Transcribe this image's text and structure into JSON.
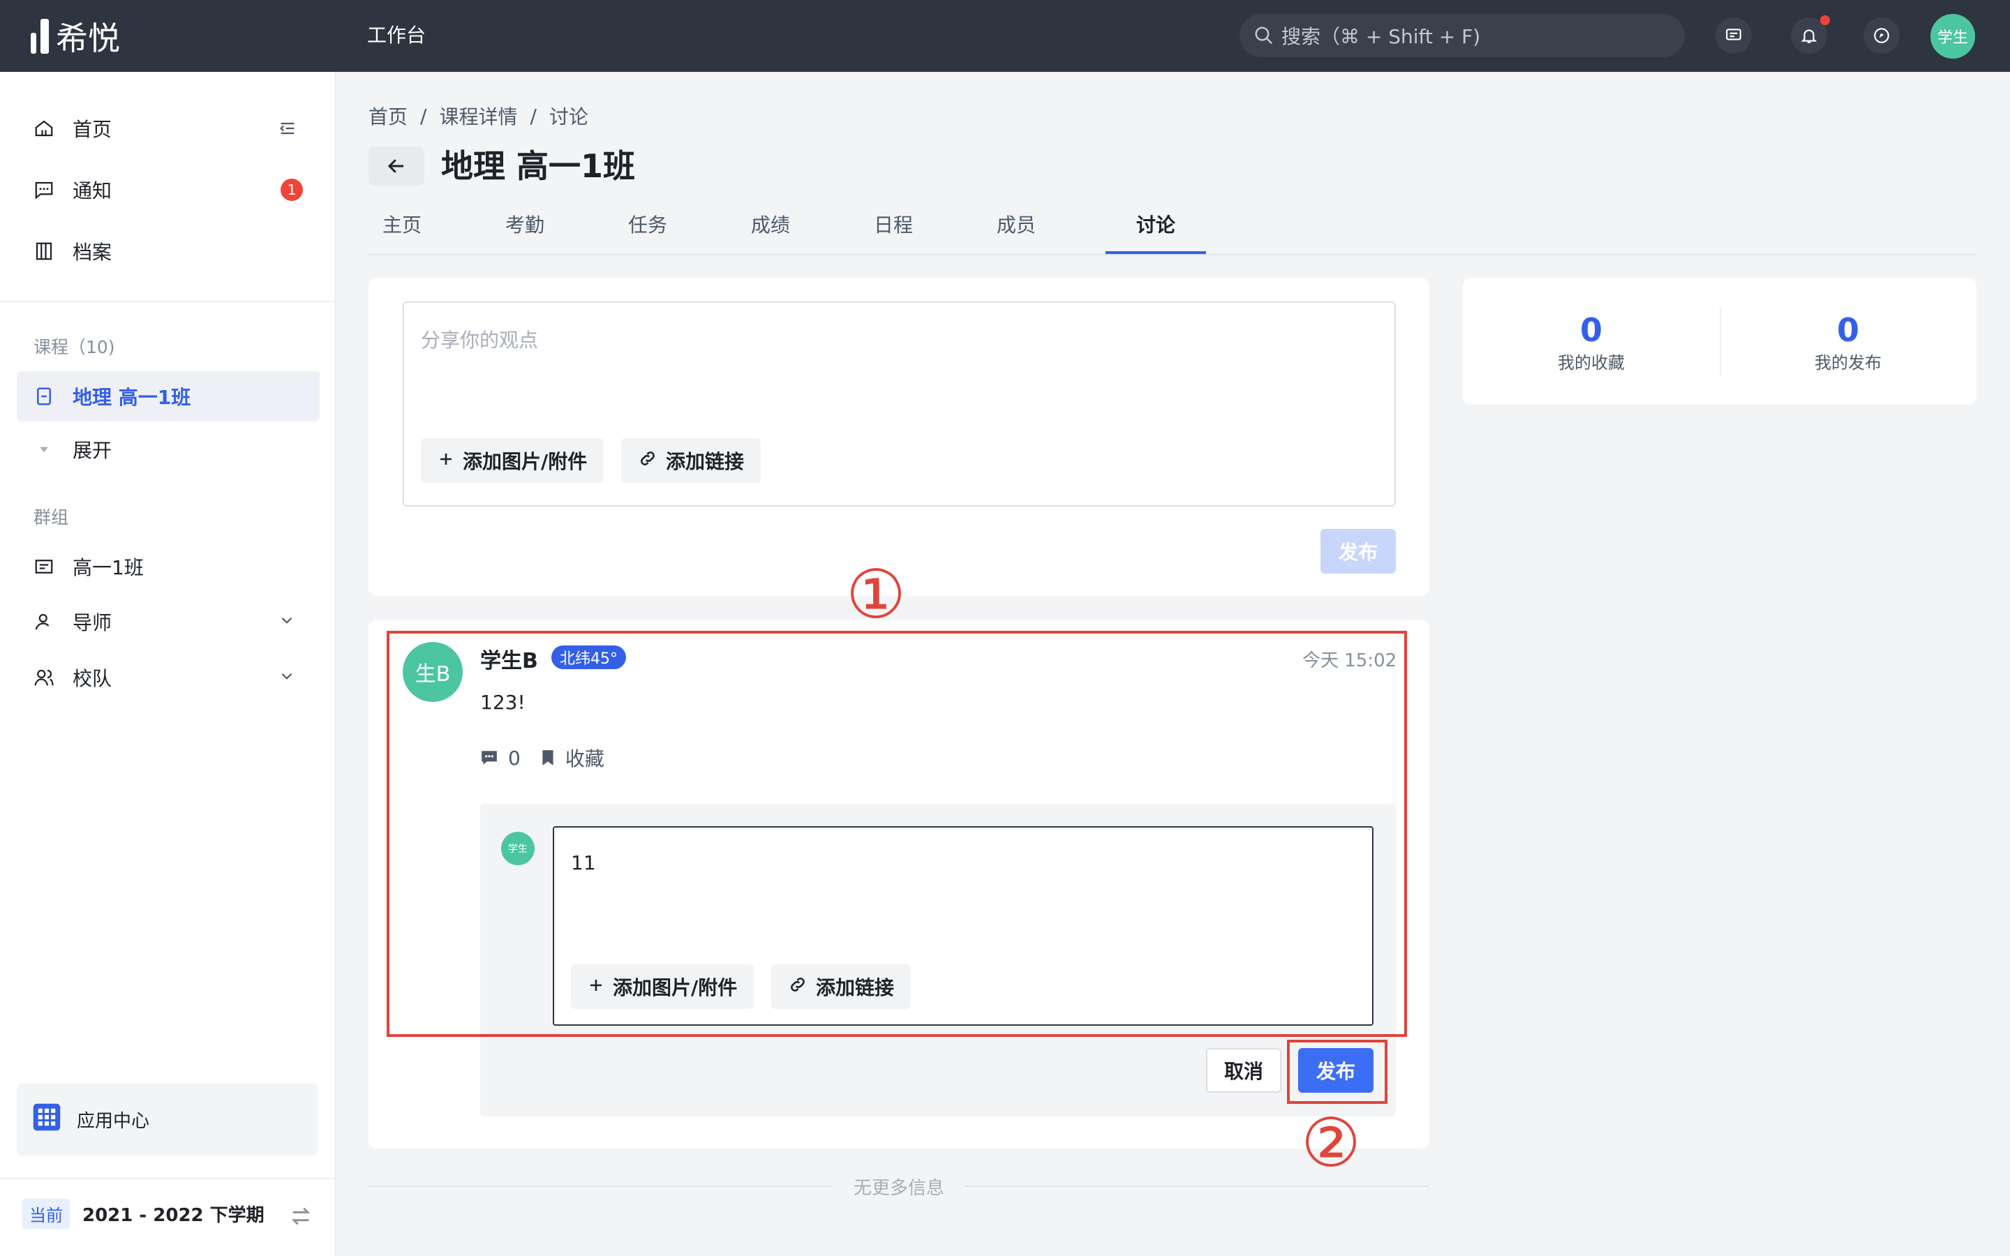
{
  "topbar": {
    "logo_text": "希悦",
    "workbench": "工作台",
    "search_placeholder": "搜索（⌘ + Shift + F)",
    "avatar": "学生"
  },
  "sidebar": {
    "home": "首页",
    "notice": "通知",
    "notice_badge": "1",
    "archive": "档案",
    "courses_header": "课程（10)",
    "course_active": "地理 高一1班",
    "expand": "展开",
    "groups_header": "群组",
    "group1": "高一1班",
    "mentor": "导师",
    "team": "校队",
    "app_center": "应用中心",
    "term_badge": "当前",
    "term": "2021 - 2022 下学期"
  },
  "breadcrumb": {
    "c1": "首页",
    "c2": "课程详情",
    "c3": "讨论",
    "sep": "/"
  },
  "page_title": "地理 高一1班",
  "tabs": [
    "主页",
    "考勤",
    "任务",
    "成绩",
    "日程",
    "成员",
    "讨论"
  ],
  "composer": {
    "placeholder": "分享你的观点",
    "add_attachment": "添加图片/附件",
    "add_link": "添加链接",
    "publish": "发布"
  },
  "stats": {
    "favorites_count": "0",
    "favorites_label": "我的收藏",
    "posts_count": "0",
    "posts_label": "我的发布"
  },
  "post": {
    "avatar": "生B",
    "author": "学生B",
    "tag": "北纬45°",
    "time": "今天 15:02",
    "body": "123!",
    "comment_count": "0",
    "favorite": "收藏"
  },
  "reply": {
    "avatar": "学生",
    "text": "11",
    "add_attachment": "添加图片/附件",
    "add_link": "添加链接",
    "cancel": "取消",
    "publish": "发布"
  },
  "annotations": {
    "a1": "①",
    "a2": "②"
  },
  "footer": {
    "no_more": "无更多信息"
  },
  "colors": {
    "accent": "#3360e6",
    "annotation": "#e0443b",
    "avatar": "#4cc6a0"
  }
}
